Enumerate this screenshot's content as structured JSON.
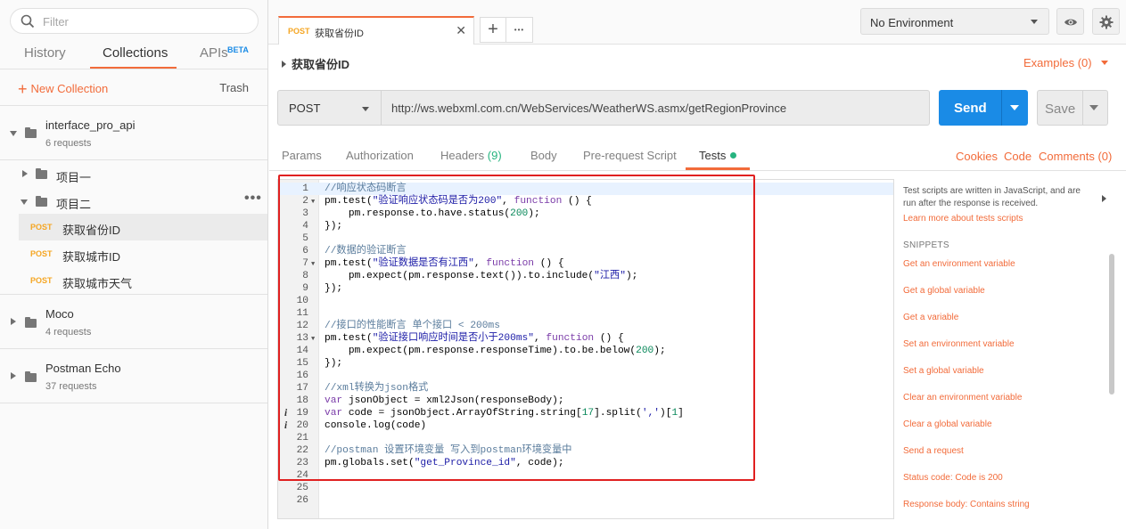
{
  "sidebar": {
    "filter_placeholder": "Filter",
    "tabs": [
      "History",
      "Collections",
      "APIs"
    ],
    "beta_badge": "BETA",
    "new_collection": "New Collection",
    "trash": "Trash",
    "collections": [
      {
        "name": "interface_pro_api",
        "count": "6 requests"
      },
      {
        "name": "Moco",
        "count": "4 requests"
      },
      {
        "name": "Postman Echo",
        "count": "37 requests"
      }
    ],
    "folders": [
      "项目一",
      "项目二"
    ],
    "requests": [
      {
        "method": "POST",
        "name": "获取省份ID"
      },
      {
        "method": "POST",
        "name": "获取城市ID"
      },
      {
        "method": "POST",
        "name": "获取城市天气"
      }
    ]
  },
  "tabbar": {
    "active_tab": {
      "method": "POST",
      "title": "获取省份ID"
    },
    "close_glyph": "✕",
    "add_glyph": "+",
    "more_glyph": "•••"
  },
  "environment": {
    "selected": "No Environment"
  },
  "request": {
    "title": "获取省份ID",
    "examples": "Examples (0)",
    "method": "POST",
    "url": "http://ws.webxml.com.cn/WebServices/WeatherWS.asmx/getRegionProvince",
    "send": "Send",
    "save": "Save"
  },
  "subtabs": {
    "params": "Params",
    "authorization": "Authorization",
    "headers": "Headers",
    "headers_count": "(9)",
    "body": "Body",
    "prerequest": "Pre-request Script",
    "tests": "Tests",
    "cookies": "Cookies",
    "code": "Code",
    "comments": "Comments (0)"
  },
  "editor_lines": [
    "//响应状态码断言",
    "pm.test(\"验证响应状态码是否为200\", function () {",
    "    pm.response.to.have.status(200);",
    "});",
    "",
    "//数据的验证断言",
    "pm.test(\"验证数据是否有江西\", function () {",
    "    pm.expect(pm.response.text()).to.include(\"江西\");",
    "});",
    "",
    "",
    "//接口的性能断言 单个接口 < 200ms",
    "pm.test(\"验证接口响应时间是否小于200ms\", function () {",
    "    pm.expect(pm.response.responseTime).to.be.below(200);",
    "});",
    "",
    "//xml转换为json格式",
    "var jsonObject = xml2Json(responseBody);",
    "var code = jsonObject.ArrayOfString.string[17].split(',')[1]",
    "console.log(code)",
    "",
    "//postman 设置环境变量 写入到postman环境变量中",
    "pm.globals.set(\"get_Province_id\", code);",
    "",
    "",
    ""
  ],
  "help": {
    "text": "Test scripts are written in JavaScript, and are run after the response is received.",
    "learn_more": "Learn more about tests scripts",
    "snippets_heading": "SNIPPETS",
    "snippets": [
      "Get an environment variable",
      "Get a global variable",
      "Get a variable",
      "Set an environment variable",
      "Set a global variable",
      "Clear an environment variable",
      "Clear a global variable",
      "Send a request",
      "Status code: Code is 200",
      "Response body: Contains string"
    ]
  },
  "colors": {
    "accent": "#f26b3a",
    "send_blue": "#1a8be6",
    "tests_dot": "#26b47f",
    "highlight_box": "#e02020"
  }
}
